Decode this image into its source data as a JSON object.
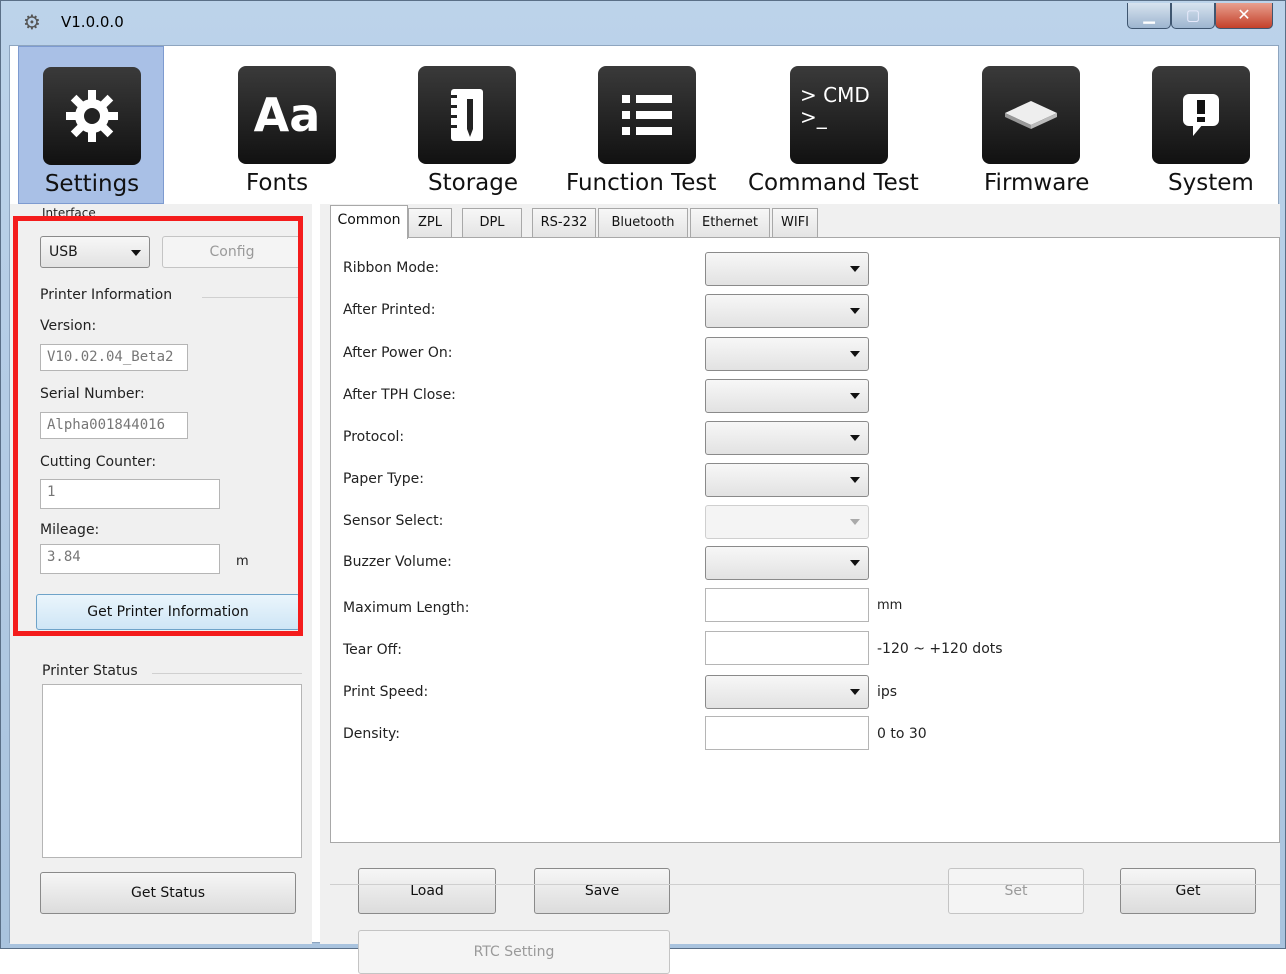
{
  "window": {
    "title": "V1.0.0.0",
    "app_icon": "gear-icon"
  },
  "toolbar": {
    "items": [
      {
        "label": "Settings",
        "icon": "gear-icon"
      },
      {
        "label": "Fonts",
        "icon": "fonts-icon",
        "glyph": "Aa"
      },
      {
        "label": "Storage",
        "icon": "storage-notebook-icon"
      },
      {
        "label": "Function Test",
        "icon": "list-icon"
      },
      {
        "label": "Command Test",
        "icon": "terminal-icon",
        "glyph1": "> CMD",
        "glyph2": ">_"
      },
      {
        "label": "Firmware",
        "icon": "chip-icon"
      },
      {
        "label": "System",
        "icon": "alert-bubble-icon"
      }
    ]
  },
  "left": {
    "interface_title": "Interface",
    "interface_value": "USB",
    "config_label": "Config",
    "printer_info_title": "Printer Information",
    "version_label": "Version:",
    "version_value": "V10.02.04_Beta2",
    "serial_label": "Serial Number:",
    "serial_value": "Alpha001844016",
    "cutting_label": "Cutting Counter:",
    "cutting_value": "1",
    "mileage_label": "Mileage:",
    "mileage_value": "3.84",
    "mileage_unit": "m",
    "get_info_label": "Get Printer Information",
    "status_title": "Printer Status",
    "get_status_label": "Get Status"
  },
  "tabs": [
    "Common",
    "ZPL",
    "DPL",
    "RS-232",
    "Bluetooth",
    "Ethernet",
    "WIFI"
  ],
  "common": {
    "rows": [
      {
        "label": "Ribbon Mode:",
        "type": "combo"
      },
      {
        "label": "After Printed:",
        "type": "combo"
      },
      {
        "label": "After Power On:",
        "type": "combo"
      },
      {
        "label": "After TPH Close:",
        "type": "combo"
      },
      {
        "label": "Protocol:",
        "type": "combo"
      },
      {
        "label": "Paper Type:",
        "type": "combo"
      },
      {
        "label": "Sensor Select:",
        "type": "combo-disabled"
      },
      {
        "label": "Buzzer Volume:",
        "type": "combo"
      },
      {
        "label": "Maximum Length:",
        "type": "text",
        "unit": "mm"
      },
      {
        "label": "Tear Off:",
        "type": "text",
        "unit": "-120 ~ +120 dots"
      },
      {
        "label": "Print Speed:",
        "type": "combo",
        "unit": "ips"
      },
      {
        "label": "Density:",
        "type": "text",
        "unit": "0 to 30"
      }
    ]
  },
  "buttons": {
    "load": "Load",
    "save": "Save",
    "set": "Set",
    "get": "Get",
    "rtc": "RTC Setting"
  },
  "colors": {
    "highlight_frame": "#f41c1c",
    "active_tool": "#a9c0e6"
  }
}
